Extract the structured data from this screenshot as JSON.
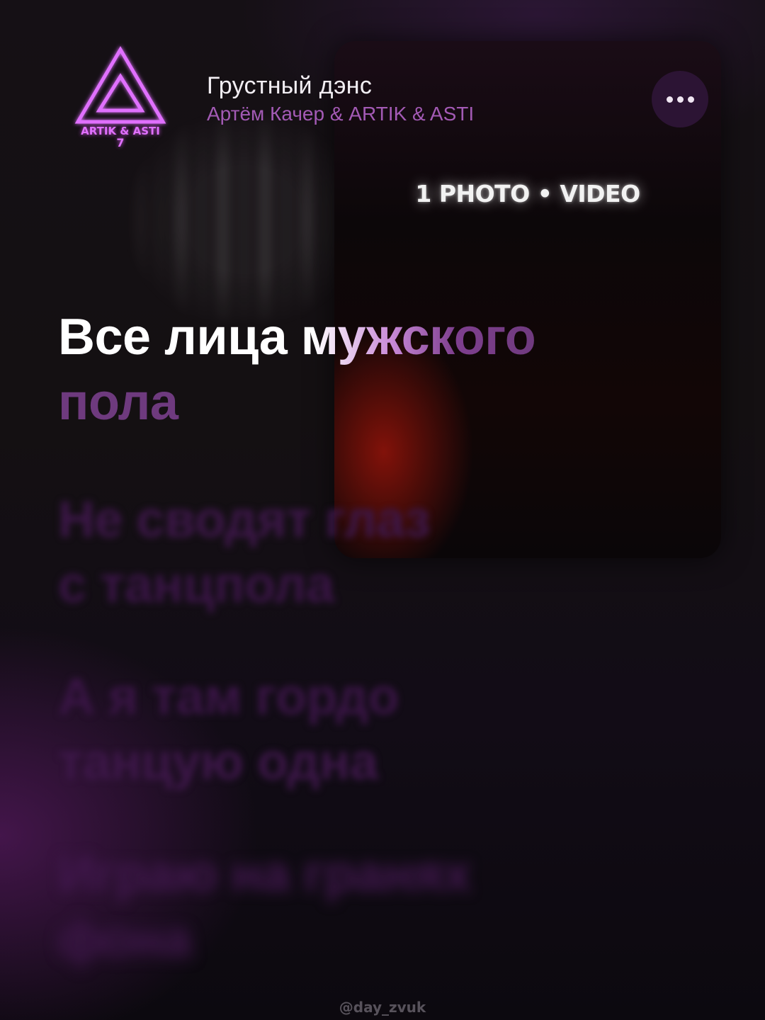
{
  "track": {
    "title": "Грустный дэнс",
    "artist": "Артём Качер & ARTIK & ASTI"
  },
  "cover": {
    "text_line1": "ARTIK & ASTI",
    "text_line2": "7",
    "accent_color": "#e070ff",
    "icon": "triangle-logo-icon"
  },
  "video": {
    "label": "1 PHOTO • VIDEO"
  },
  "more_button": {
    "icon": "more-dots-icon"
  },
  "lyrics": {
    "active": [
      "Все лица мужского",
      "пола"
    ],
    "upcoming": [
      "Не сводят глаз",
      "с танцпола",
      "А я там гордо",
      "танцую одна",
      "Играю на гранях",
      "фона"
    ]
  },
  "watermark": "@day_zvuk",
  "colors": {
    "active_lyric": "#ffffff",
    "lyric_dim": "#6e3a7e",
    "artist": "#a35ab5"
  }
}
